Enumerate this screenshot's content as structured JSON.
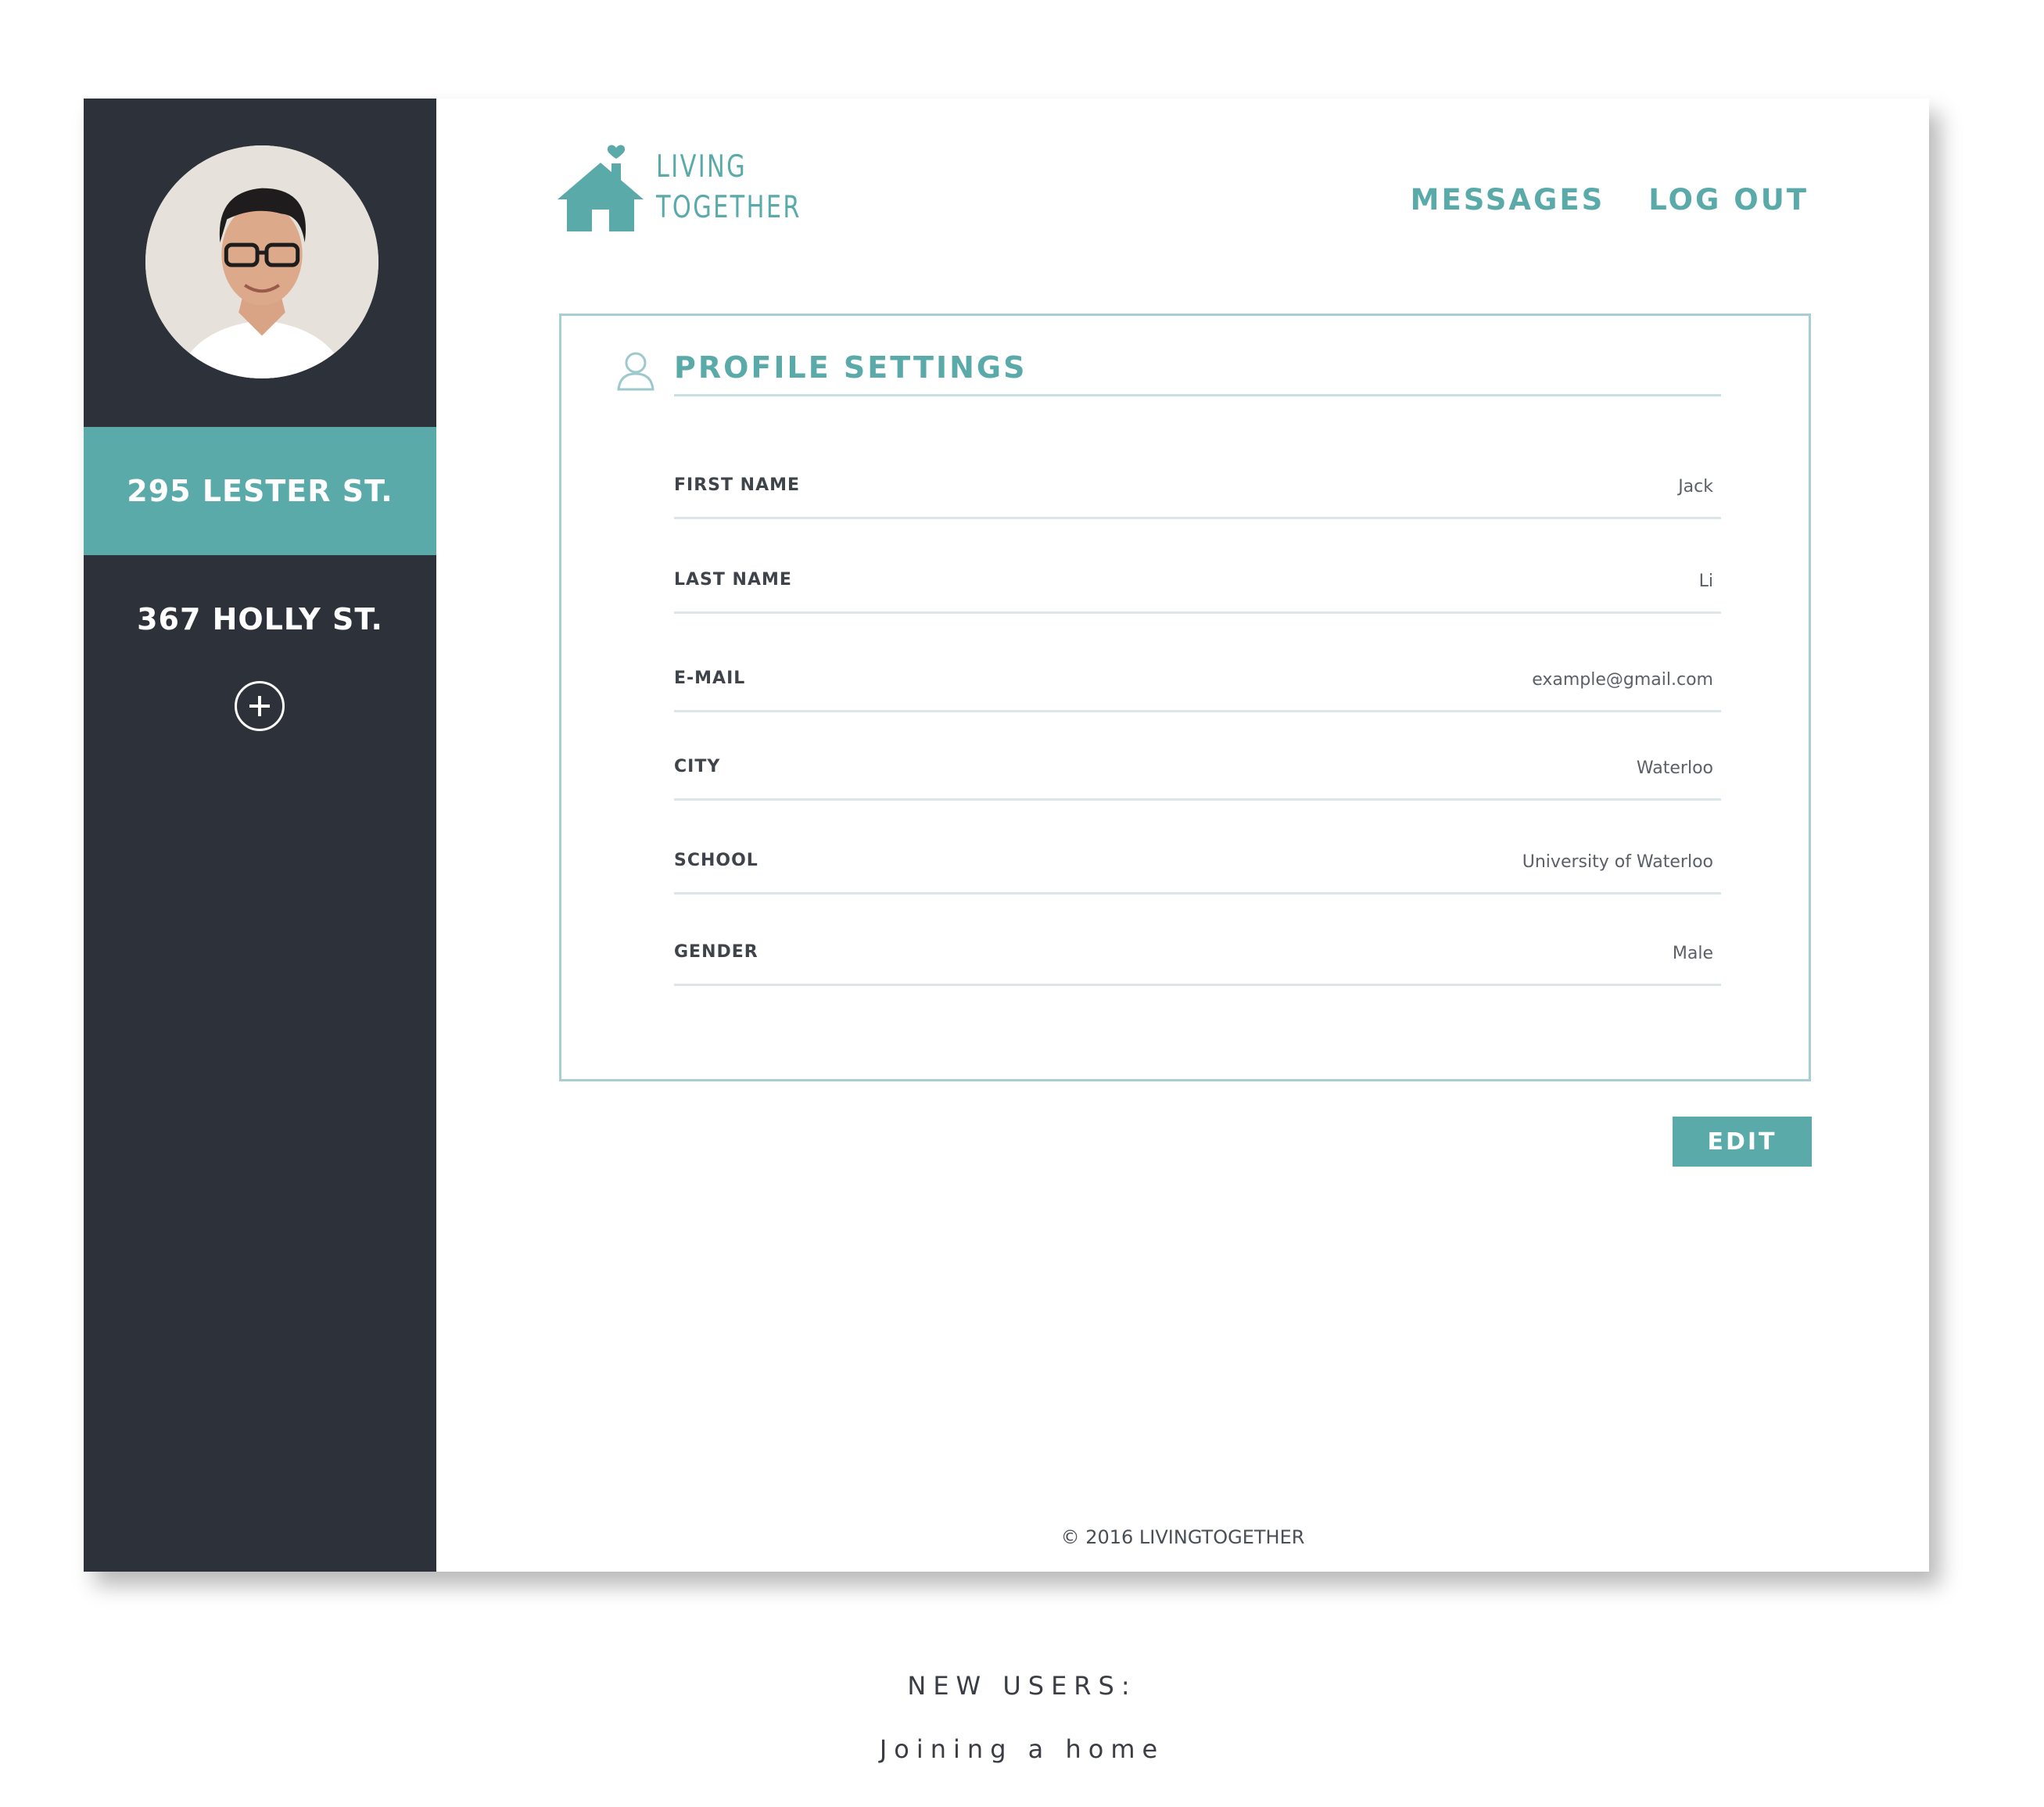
{
  "sidebar": {
    "avatar": "user-profile-photo",
    "homes": [
      {
        "label": "295 LESTER ST.",
        "active": true
      },
      {
        "label": "367 HOLLY ST.",
        "active": false
      }
    ],
    "add_home_icon": "plus-circle-icon"
  },
  "header": {
    "logo_line1": "LIVING",
    "logo_line2": "TOGETHER",
    "logo_icon": "house-heart-icon",
    "nav": {
      "messages": "MESSAGES",
      "logout": "LOG OUT"
    }
  },
  "profile": {
    "title": "PROFILE SETTINGS",
    "title_icon": "user-outline-icon",
    "fields": [
      {
        "label": "FIRST NAME",
        "value": "Jack"
      },
      {
        "label": "LAST NAME",
        "value": "Li"
      },
      {
        "label": "E-MAIL",
        "value": "example@gmail.com"
      },
      {
        "label": "CITY",
        "value": "Waterloo"
      },
      {
        "label": "SCHOOL",
        "value": "University of Waterloo"
      },
      {
        "label": "GENDER",
        "value": "Male"
      }
    ],
    "edit_label": "EDIT"
  },
  "footer": {
    "copyright": "© 2016 LIVINGTOGETHER"
  },
  "caption": {
    "title": "NEW USERS:",
    "subtitle": "Joining a home"
  },
  "colors": {
    "accent": "#5aaaaa",
    "sidebar": "#2c313a",
    "card_border": "#a7cfd3"
  }
}
